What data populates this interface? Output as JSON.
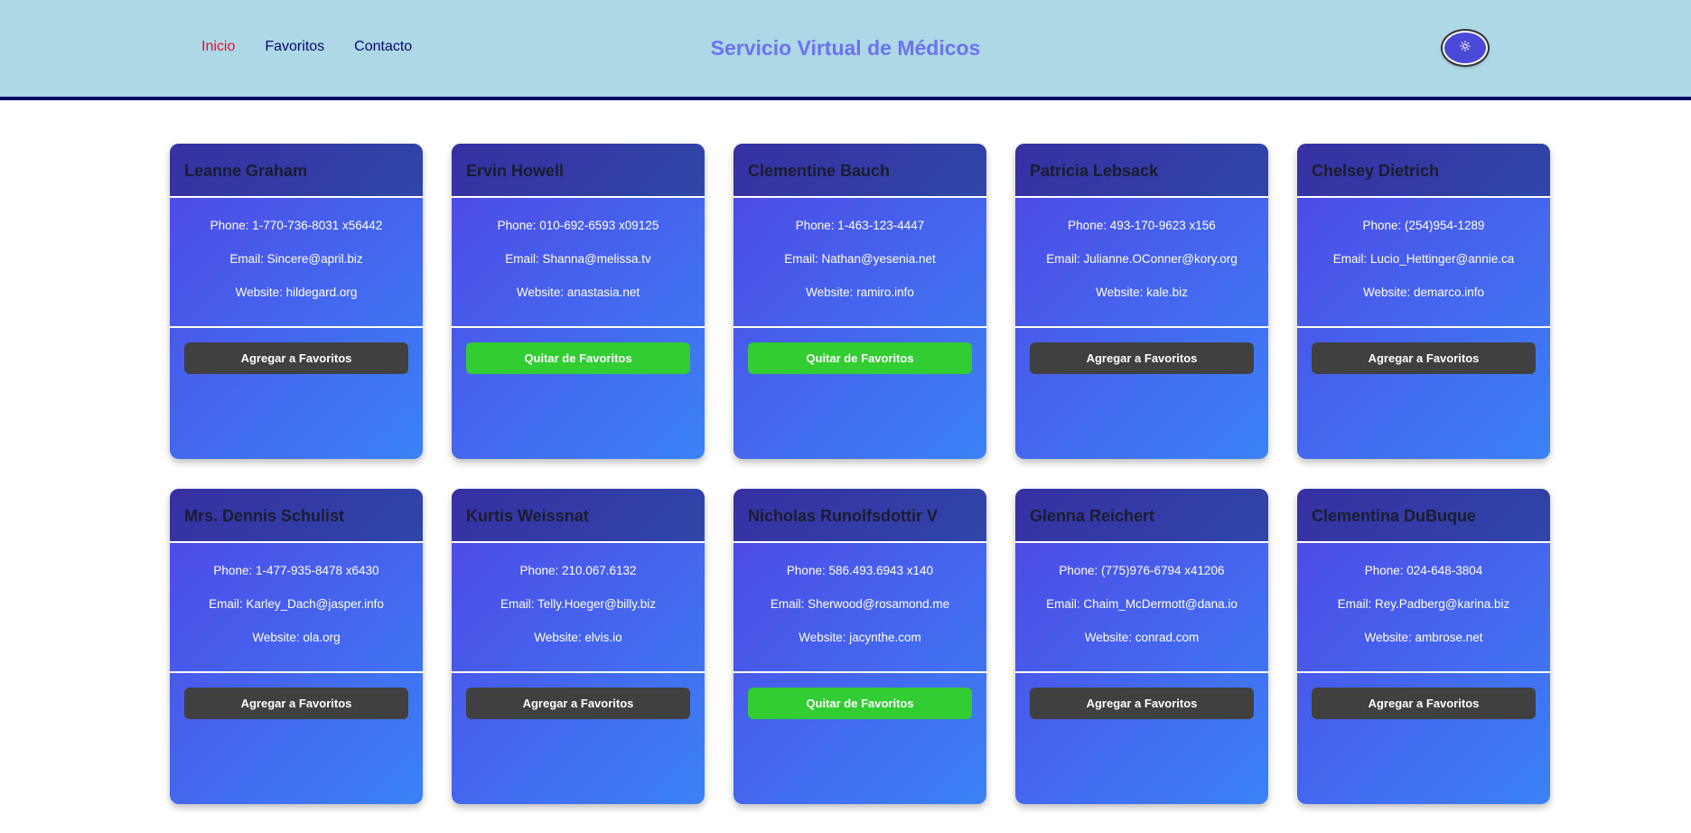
{
  "header": {
    "nav": [
      {
        "label": "Inicio",
        "active": true
      },
      {
        "label": "Favoritos",
        "active": false
      },
      {
        "label": "Contacto",
        "active": false
      }
    ],
    "title": "Servicio Virtual de Médicos",
    "theme_toggle_icon": "sun-icon"
  },
  "colors": {
    "header_bg": "#add8e6",
    "header_border": "#0a0a6a",
    "nav_active": "#e8102a",
    "nav_text": "#0a0a6a",
    "title": "#6b73f0",
    "card_gradient_start": "#4f46e5",
    "card_gradient_end": "#3b82f6",
    "add_button": "#404040",
    "remove_button": "#32cd32"
  },
  "doctors": [
    {
      "name": "Leanne Graham",
      "phone": "Phone: 1-770-736-8031 x56442",
      "email": "Email: Sincere@april.biz",
      "website": "Website: hildegard.org",
      "button": "Agregar a Favoritos",
      "favorite": false
    },
    {
      "name": "Ervin Howell",
      "phone": "Phone: 010-692-6593 x09125",
      "email": "Email: Shanna@melissa.tv",
      "website": "Website: anastasia.net",
      "button": "Quitar de Favoritos",
      "favorite": true
    },
    {
      "name": "Clementine Bauch",
      "phone": "Phone: 1-463-123-4447",
      "email": "Email: Nathan@yesenia.net",
      "website": "Website: ramiro.info",
      "button": "Quitar de Favoritos",
      "favorite": true
    },
    {
      "name": "Patricia Lebsack",
      "phone": "Phone: 493-170-9623 x156",
      "email": "Email: Julianne.OConner@kory.org",
      "website": "Website: kale.biz",
      "button": "Agregar a Favoritos",
      "favorite": false
    },
    {
      "name": "Chelsey Dietrich",
      "phone": "Phone: (254)954-1289",
      "email": "Email: Lucio_Hettinger@annie.ca",
      "website": "Website: demarco.info",
      "button": "Agregar a Favoritos",
      "favorite": false
    },
    {
      "name": "Mrs. Dennis Schulist",
      "phone": "Phone: 1-477-935-8478 x6430",
      "email": "Email: Karley_Dach@jasper.info",
      "website": "Website: ola.org",
      "button": "Agregar a Favoritos",
      "favorite": false
    },
    {
      "name": "Kurtis Weissnat",
      "phone": "Phone: 210.067.6132",
      "email": "Email: Telly.Hoeger@billy.biz",
      "website": "Website: elvis.io",
      "button": "Agregar a Favoritos",
      "favorite": false
    },
    {
      "name": "Nicholas Runolfsdottir V",
      "phone": "Phone: 586.493.6943 x140",
      "email": "Email: Sherwood@rosamond.me",
      "website": "Website: jacynthe.com",
      "button": "Quitar de Favoritos",
      "favorite": true
    },
    {
      "name": "Glenna Reichert",
      "phone": "Phone: (775)976-6794 x41206",
      "email": "Email: Chaim_McDermott@dana.io",
      "website": "Website: conrad.com",
      "button": "Agregar a Favoritos",
      "favorite": false
    },
    {
      "name": "Clementina DuBuque",
      "phone": "Phone: 024-648-3804",
      "email": "Email: Rey.Padberg@karina.biz",
      "website": "Website: ambrose.net",
      "button": "Agregar a Favoritos",
      "favorite": false
    }
  ]
}
